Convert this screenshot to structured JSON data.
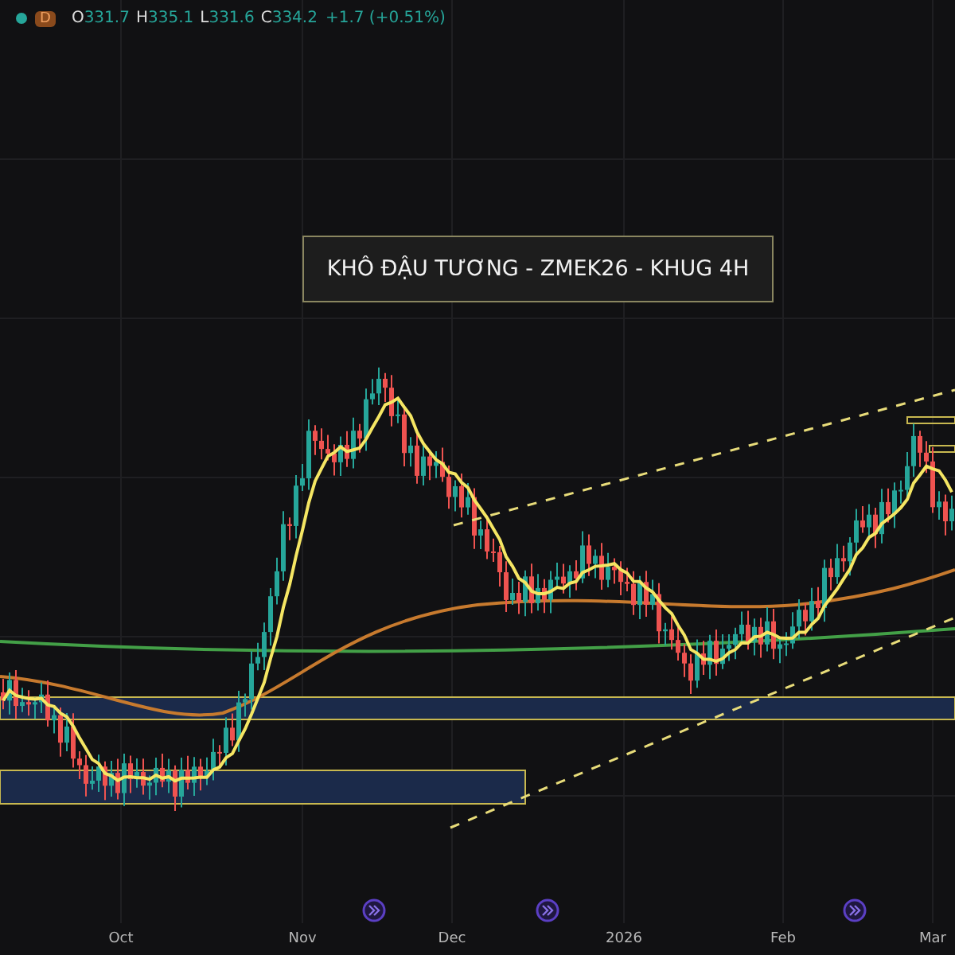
{
  "legend": {
    "interval": "D",
    "values": [
      {
        "label": "O",
        "value": "331.7"
      },
      {
        "label": "H",
        "value": "335.1"
      },
      {
        "label": "L",
        "value": "331.6"
      },
      {
        "label": "C",
        "value": "334.2"
      }
    ],
    "change": "+1.7 (+0.51%)"
  },
  "title": "KHÔ ĐẬU TƯƠNG - ZMEK26 - KHUG 4H",
  "x_axis": {
    "labels": [
      "Oct",
      "Nov",
      "Dec",
      "2026",
      "Feb",
      "Mar"
    ]
  },
  "events": [
    {
      "kind": "earnings"
    },
    {
      "kind": "earnings"
    },
    {
      "kind": "earnings"
    }
  ]
}
